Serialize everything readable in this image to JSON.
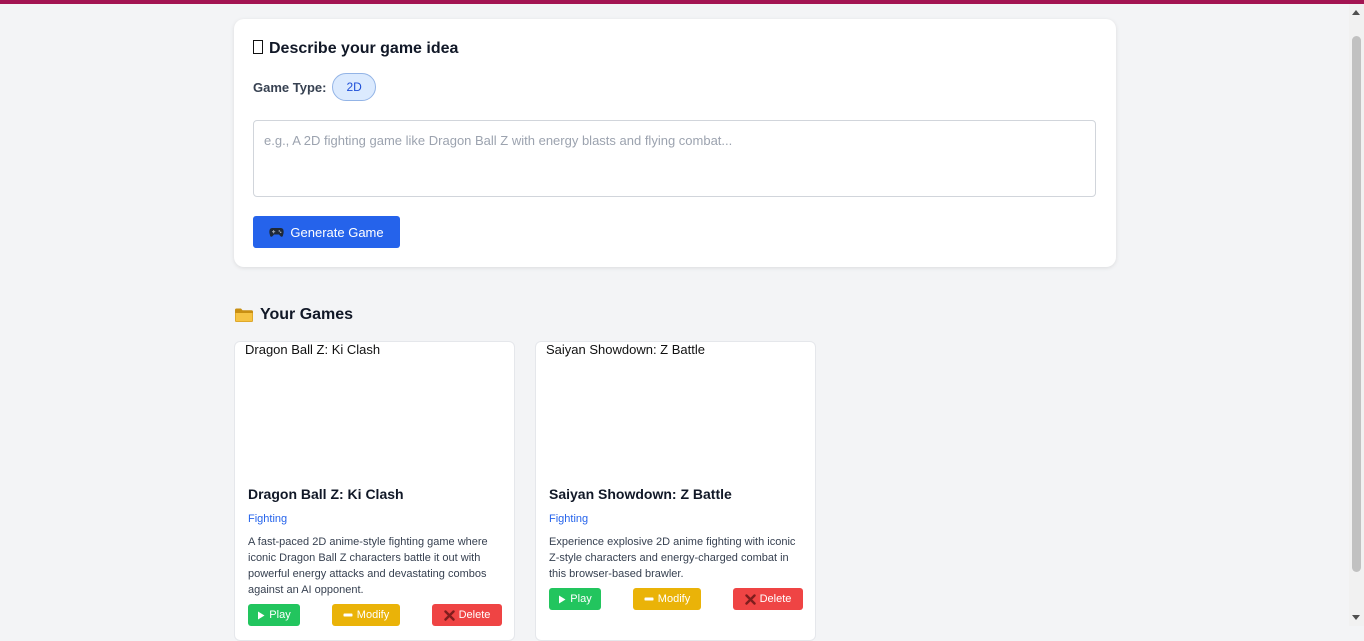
{
  "prompt_card": {
    "title": "Describe your game idea",
    "game_type_label": "Game Type:",
    "game_type_value": "2D",
    "input_placeholder": "e.g., A 2D fighting game like Dragon Ball Z with energy blasts and flying combat...",
    "input_value": "",
    "generate_label": "Generate Game"
  },
  "games_section": {
    "heading": "Your Games",
    "games": [
      {
        "image_alt": "Dragon Ball Z: Ki Clash",
        "title": "Dragon Ball Z: Ki Clash",
        "genre": "Fighting",
        "description": "A fast-paced 2D anime-style fighting game where iconic Dragon Ball Z characters battle it out with powerful energy attacks and devastating combos against an AI opponent.",
        "play_label": "Play",
        "modify_label": "Modify",
        "delete_label": "Delete"
      },
      {
        "image_alt": "Saiyan Showdown: Z Battle",
        "title": "Saiyan Showdown: Z Battle",
        "genre": "Fighting",
        "description": "Experience explosive 2D anime fighting with iconic Z-style characters and energy-charged combat in this browser-based brawler.",
        "play_label": "Play",
        "modify_label": "Modify",
        "delete_label": "Delete"
      }
    ]
  },
  "colors": {
    "top_bar": "#a31452",
    "primary": "#2563eb",
    "play": "#22c55e",
    "modify": "#eab308",
    "delete": "#ef4444",
    "background": "#f3f4f6"
  },
  "icons": {
    "prompt_title": "missing-glyph-icon",
    "generate": "gamepad-icon",
    "games_heading": "folder-icon",
    "play": "play-icon",
    "modify": "minus-icon",
    "delete": "cross-icon"
  }
}
